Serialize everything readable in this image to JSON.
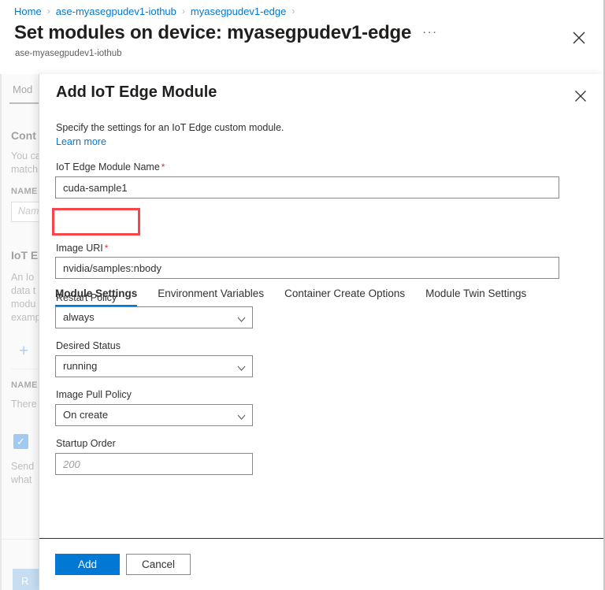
{
  "blade": {
    "breadcrumb": [
      "Home",
      "ase-myasegpudev1-iothub",
      "myasegpudev1-edge"
    ],
    "separator": "›",
    "title": "Set modules on device: myasegpudev1-edge",
    "ellipsis": "···",
    "subtitle": "ase-myasegpudev1-iothub"
  },
  "background": {
    "tab_label": "Mod",
    "section1_title": "Cont",
    "section1_text_line1": "You ca",
    "section1_text_line2": "match",
    "name_header": "NAME",
    "name_placeholder": "Nam",
    "section2_title": "IoT E",
    "section2_text_line1": "An Io",
    "section2_text_line2": "data t",
    "section2_text_line3": "modu",
    "section2_text_line4": "examp",
    "add_icon": "+",
    "name_header2": "NAME",
    "empty_text": "There",
    "check_icon": "✓",
    "send_text_line1": "Send",
    "send_text_line2": "what",
    "footer_button": "R"
  },
  "dialog": {
    "title": "Add IoT Edge Module",
    "close_icon": "close-icon",
    "description": "Specify the settings for an IoT Edge custom module.",
    "learn_more": "Learn more",
    "module_name": {
      "label": "IoT Edge Module Name",
      "required": "*",
      "value": "cuda-sample1",
      "placeholder": ""
    },
    "tabs": [
      {
        "label": "Module Settings",
        "active": true
      },
      {
        "label": "Environment Variables",
        "active": false
      },
      {
        "label": "Container Create Options",
        "active": false
      },
      {
        "label": "Module Twin Settings",
        "active": false
      }
    ],
    "fields": {
      "image_uri": {
        "label": "Image URI",
        "required": "*",
        "value": "nvidia/samples:nbody",
        "placeholder": ""
      },
      "restart_policy": {
        "label": "Restart Policy",
        "value": "always"
      },
      "desired_status": {
        "label": "Desired Status",
        "value": "running"
      },
      "image_pull_policy": {
        "label": "Image Pull Policy",
        "value": "On create"
      },
      "startup_order": {
        "label": "Startup Order",
        "value": "",
        "placeholder": "200"
      }
    },
    "footer": {
      "add_label": "Add",
      "cancel_label": "Cancel"
    }
  },
  "colors": {
    "accent": "#0078d4",
    "link": "#0078d4",
    "required": "#d13438",
    "highlight": "#f8444b"
  }
}
